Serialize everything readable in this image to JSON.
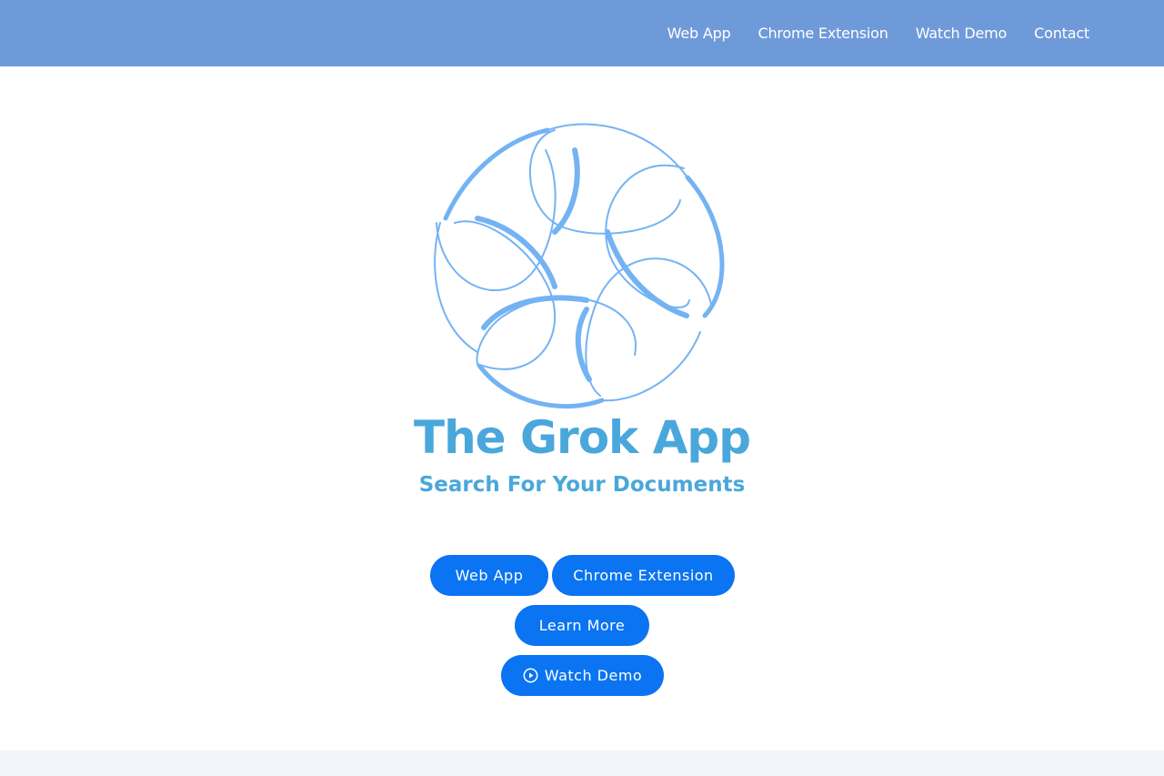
{
  "nav": {
    "items": [
      {
        "label": "Web App"
      },
      {
        "label": "Chrome Extension"
      },
      {
        "label": "Watch Demo"
      },
      {
        "label": "Contact"
      }
    ]
  },
  "hero": {
    "logo_icon": "swirl-circle-logo",
    "title": "The Grok App",
    "subtitle": "Search For Your Documents",
    "buttons": {
      "web_app": "Web App",
      "chrome_extension": "Chrome Extension",
      "learn_more": "Learn More",
      "watch_demo": "Watch Demo",
      "watch_demo_icon": "play-circle-icon"
    }
  },
  "colors": {
    "header_bg": "#6f9ad9",
    "accent_text": "#4aa7db",
    "button_bg": "#0a74f2",
    "logo_stroke": "#6fb4f2",
    "footer_bg": "#f3f5fa"
  }
}
